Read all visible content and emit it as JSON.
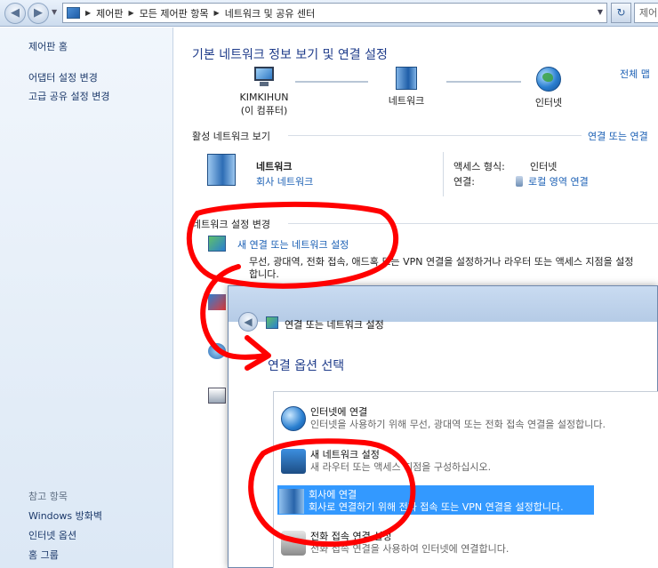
{
  "address_bar": {
    "back_glyph": "◀",
    "forward_glyph": "▶",
    "breadcrumb": [
      "제어판",
      "모든 제어판 항목",
      "네트워크 및 공유 센터"
    ],
    "refresh_glyph": "↻",
    "search_text": "제어"
  },
  "sidebar": {
    "links": [
      "제어판 홈",
      "어댑터 설정 변경",
      "고급 공유 설정 변경"
    ],
    "see_also_header": "참고 항목",
    "see_also": [
      "Windows 방화벽",
      "인터넷 옵션",
      "홈 그룹"
    ]
  },
  "main": {
    "title": "기본 네트워크 정보 보기 및 연결 설정",
    "full_map_link": "전체 맵",
    "map_nodes": [
      {
        "label": "KIMKIHUN",
        "sublabel": "(이 컴퓨터)",
        "icon": "computer-icon"
      },
      {
        "label": "네트워크",
        "icon": "network-icon"
      },
      {
        "label": "인터넷",
        "icon": "globe-icon"
      }
    ],
    "active_networks_label": "활성 네트워크 보기",
    "connect_disconnect_link": "연결 또는 연결",
    "network_name": "네트워크",
    "network_type": "회사 네트워크",
    "access_type_label": "액세스 형식:",
    "access_type_value": "인터넷",
    "connections_label": "연결:",
    "connections_value": "로컬 영역 연결",
    "change_settings_label": "네트워크 설정 변경",
    "setup_link": "새 연결 또는 네트워크 설정",
    "setup_desc_line1": "무선, 광대역, 전화 접속, 애드혹 또는 VPN 연결을 설정하거나 라우터 또는 액세스 지점을 설정",
    "setup_desc_line2": "합니다."
  },
  "dialog": {
    "title": "연결 또는 네트워크 설정",
    "heading": "연결 옵션 선택",
    "options": [
      {
        "title": "인터넷에 연결",
        "desc": "인터넷을 사용하기 위해 무선, 광대역 또는 전화 접속 연결을 설정합니다.",
        "icon": "internet-globe-icon",
        "selected": false
      },
      {
        "title": "새 네트워크 설정",
        "desc": "새 라우터 또는 액세스 지점을 구성하십시오.",
        "icon": "router-icon",
        "selected": false
      },
      {
        "title": "회사에 연결",
        "desc": "회사로 연결하기 위해 전화 접속 또는 VPN 연결을 설정합니다.",
        "icon": "workplace-icon",
        "selected": true
      },
      {
        "title": "전화 접속 연결 설정",
        "desc": "전화 접속 연결을 사용하여 인터넷에 연결합니다.",
        "icon": "dialup-phone-icon",
        "selected": false
      }
    ]
  },
  "annotation_color": "#ff0000",
  "highlight_color": "#3399ff",
  "title_color": "#1e3b8a",
  "link_color": "#1a5fb4"
}
